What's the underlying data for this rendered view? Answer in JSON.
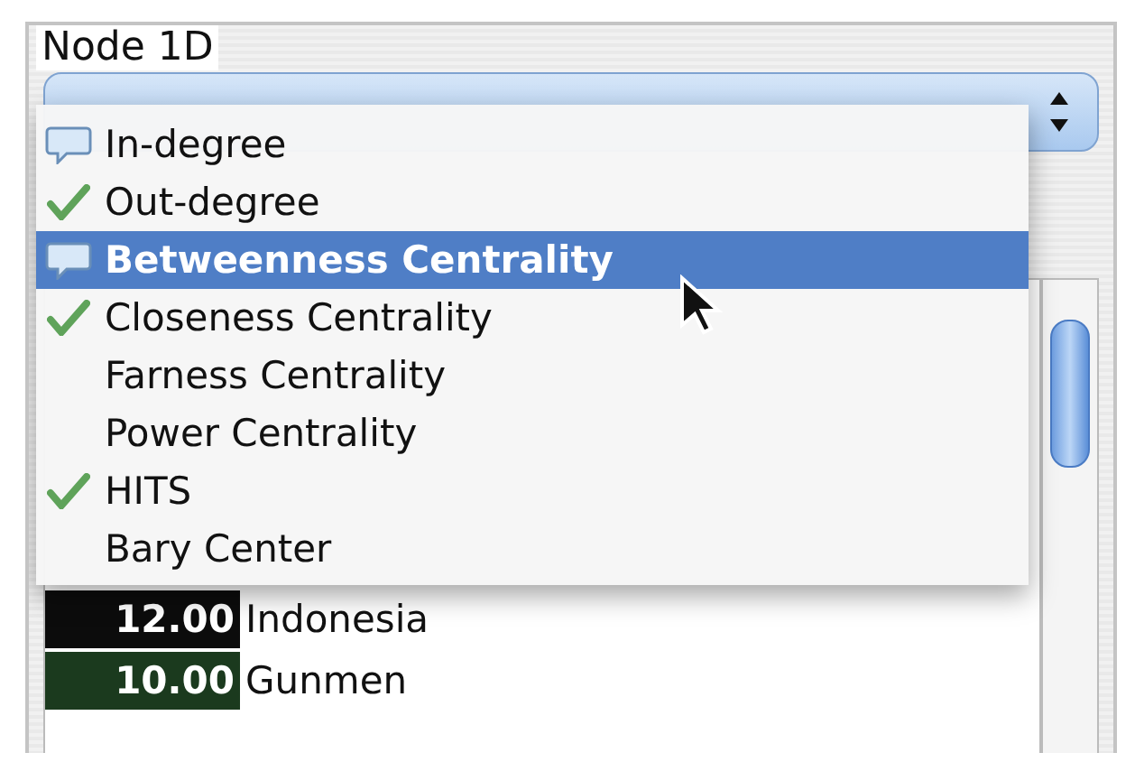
{
  "panel": {
    "title": "Node 1D"
  },
  "menu": [
    {
      "label": "In-degree",
      "kind": "bubble",
      "selected": false
    },
    {
      "label": "Out-degree",
      "kind": "check",
      "selected": false
    },
    {
      "label": "Betweenness Centrality",
      "kind": "bubble",
      "selected": true
    },
    {
      "label": "Closeness Centrality",
      "kind": "check",
      "selected": false
    },
    {
      "label": "Farness Centrality",
      "kind": "plain",
      "selected": false
    },
    {
      "label": "Power Centrality",
      "kind": "plain",
      "selected": false
    },
    {
      "label": "HITS",
      "kind": "check",
      "selected": false
    },
    {
      "label": "Bary Center",
      "kind": "plain",
      "selected": false
    }
  ],
  "rows": [
    {
      "value": "12.00",
      "name": "Indonesia",
      "color": "#0c0c0c"
    },
    {
      "value": "10.00",
      "name": "Gunmen",
      "color": "#1b3a1e"
    }
  ]
}
